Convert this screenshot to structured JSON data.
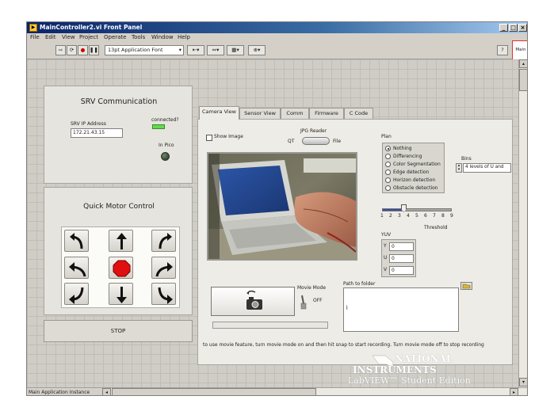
{
  "window": {
    "title": "MainController2.vi Front Panel",
    "minimize": "_",
    "maximize": "□",
    "close": "×"
  },
  "menu": [
    "File",
    "Edit",
    "View",
    "Project",
    "Operate",
    "Tools",
    "Window",
    "Help"
  ],
  "toolbar": {
    "font": "13pt Application Font",
    "main_label": "Main"
  },
  "srv": {
    "title": "SRV Communication",
    "ip_label": "SRV IP Address",
    "ip_value": "172.21.43.15",
    "connected_label": "connected?",
    "inpico_label": "In Pico"
  },
  "motor": {
    "title": "Quick Motor Control"
  },
  "stop_button": "STOP",
  "tabs": [
    "Camera View",
    "Sensor View",
    "Comm",
    "Firmware",
    "C Code"
  ],
  "camera": {
    "show_image_label": "Show Image",
    "jpg_reader_label": "JPG Reader",
    "qt_label": "QT",
    "file_label": "File"
  },
  "plan": {
    "label": "Plan",
    "options": [
      "Nothing",
      "Differencing",
      "Color Segmentation",
      "Edge detection",
      "Horizon detection",
      "Obstacle detection"
    ],
    "selected_index": 0
  },
  "bins": {
    "label": "Bins",
    "value": "4 levels of U and"
  },
  "threshold": {
    "label": "Threshold",
    "ticks": [
      "1",
      "2",
      "3",
      "4",
      "5",
      "6",
      "7",
      "8",
      "9"
    ],
    "value": 3.5,
    "min": 1,
    "max": 9
  },
  "yuv": {
    "label": "YUV",
    "rows": [
      {
        "label": "Y",
        "value": "0"
      },
      {
        "label": "U",
        "value": "0"
      },
      {
        "label": "V",
        "value": "0"
      }
    ]
  },
  "movie": {
    "mode_label": "Movie Mode",
    "state": "OFF"
  },
  "path": {
    "label": "Path to folder",
    "value": ""
  },
  "instructions": "to use movie feature, turn movie mode on and then hit snap to start recording.  Turn movie mode off to stop recording",
  "branding": {
    "line1": "NATIONAL",
    "line2": "INSTRUMENTS",
    "line3": "LabVIEW™ Student Edition"
  },
  "status": {
    "instance": "Main Application Instance"
  },
  "colors": {
    "title_bar": "#0a246a",
    "led_connected": "#5fdc4a",
    "led_inpico": "#2f4a2f",
    "stop_octagon": "#e01010",
    "slider_fill": "#3a4ea0"
  }
}
